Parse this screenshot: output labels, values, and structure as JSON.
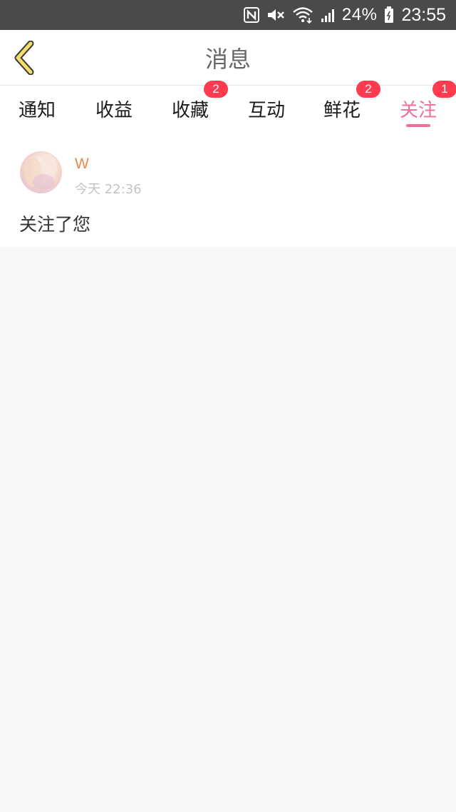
{
  "status_bar": {
    "battery": "24%",
    "time": "23:55",
    "icons": [
      "nfc-icon",
      "mute-icon",
      "wifi-icon",
      "signal-icon",
      "battery-icon"
    ]
  },
  "header": {
    "title": "消息",
    "back_icon": "chevron-left-icon"
  },
  "tabs": [
    {
      "label": "通知",
      "badge": ""
    },
    {
      "label": "收益",
      "badge": ""
    },
    {
      "label": "收藏",
      "badge": "2"
    },
    {
      "label": "互动",
      "badge": ""
    },
    {
      "label": "鲜花",
      "badge": "2"
    },
    {
      "label": "关注",
      "badge": "1",
      "active": true
    }
  ],
  "messages": [
    {
      "username": "W",
      "time": "今天 22:36",
      "text": "关注了您"
    }
  ],
  "colors": {
    "accent": "#f06d9f",
    "badge": "#ff3b4f",
    "username": "#e8884f",
    "back_arrow": "#f3dd6c"
  }
}
